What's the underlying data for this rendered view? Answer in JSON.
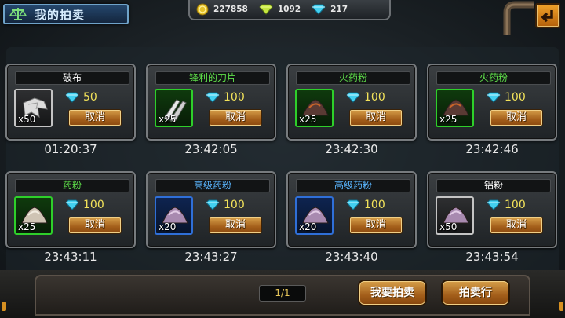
{
  "header": {
    "title": "我的拍卖",
    "currencies": [
      {
        "icon": "gold-coin-icon",
        "value": "227858"
      },
      {
        "icon": "green-gem-icon",
        "value": "1092"
      },
      {
        "icon": "blue-diamond-icon",
        "value": "217"
      }
    ]
  },
  "cancel_label": "取消",
  "listings": [
    {
      "name": "破布",
      "quality": "white",
      "icon": "rag-icon",
      "qty": "x50",
      "price": "50",
      "timer": "01:20:37"
    },
    {
      "name": "锋利的刀片",
      "quality": "green",
      "icon": "blade-icon",
      "qty": "x25",
      "price": "100",
      "timer": "23:42:05"
    },
    {
      "name": "火药粉",
      "quality": "green",
      "icon": "gunpowder-icon",
      "qty": "x25",
      "price": "100",
      "timer": "23:42:30"
    },
    {
      "name": "火药粉",
      "quality": "green",
      "icon": "gunpowder-icon",
      "qty": "x25",
      "price": "100",
      "timer": "23:42:46"
    },
    {
      "name": "药粉",
      "quality": "green",
      "icon": "medicine-powder-icon",
      "qty": "x25",
      "price": "100",
      "timer": "23:43:11"
    },
    {
      "name": "高级药粉",
      "quality": "blue",
      "icon": "advanced-powder-icon",
      "qty": "x20",
      "price": "100",
      "timer": "23:43:27"
    },
    {
      "name": "高级药粉",
      "quality": "blue",
      "icon": "advanced-powder-icon",
      "qty": "x20",
      "price": "100",
      "timer": "23:43:40"
    },
    {
      "name": "铝粉",
      "quality": "white",
      "icon": "aluminum-powder-icon",
      "qty": "x50",
      "price": "100",
      "timer": "23:43:54"
    }
  ],
  "footer": {
    "page": "1/1",
    "want_auction_label": "我要拍卖",
    "auction_house_label": "拍卖行"
  },
  "colors": {
    "white_quality": "#c4c4c4",
    "green_quality": "#2ecf2a",
    "blue_quality": "#2f6fd8",
    "price_text": "#f2e25a",
    "button_orange": "#a35e1a"
  }
}
